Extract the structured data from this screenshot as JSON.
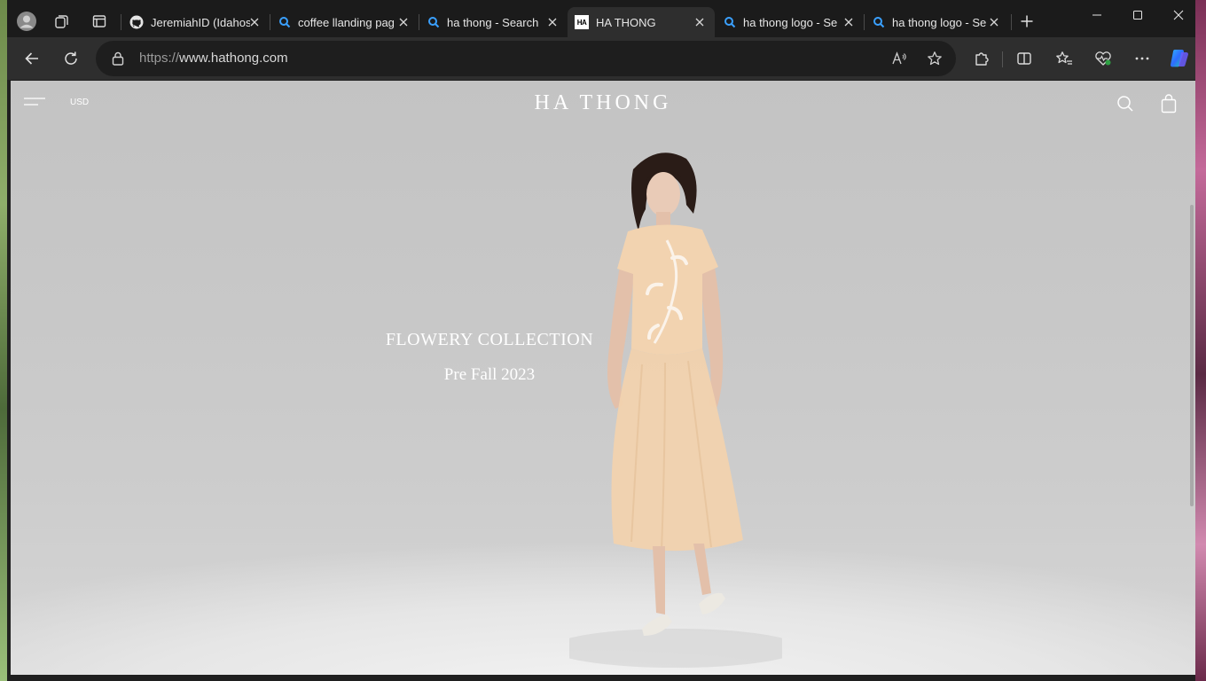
{
  "browser": {
    "tabs": [
      {
        "title": "JeremiahID (Idahos",
        "icon": "github-icon"
      },
      {
        "title": "coffee llanding pag",
        "icon": "search-icon"
      },
      {
        "title": "ha thong - Search",
        "icon": "search-icon"
      },
      {
        "title": "HA THONG",
        "icon": "ha-thong-favicon",
        "active": true
      },
      {
        "title": "ha thong logo - Se",
        "icon": "search-icon"
      },
      {
        "title": "ha thong logo - Se",
        "icon": "search-icon"
      }
    ],
    "url_protocol": "https://",
    "url_host": "www.hathong.com",
    "favicon_text": "HA"
  },
  "site": {
    "brand": "HA THONG",
    "currency": "USD",
    "hero_title": "FLOWERY COLLECTION",
    "hero_subtitle": "Pre Fall 2023"
  },
  "colors": {
    "accent_edge": "#0f6cbd",
    "tab_bg": "#1b1b1b",
    "toolbar_bg": "#2e2e2e"
  }
}
